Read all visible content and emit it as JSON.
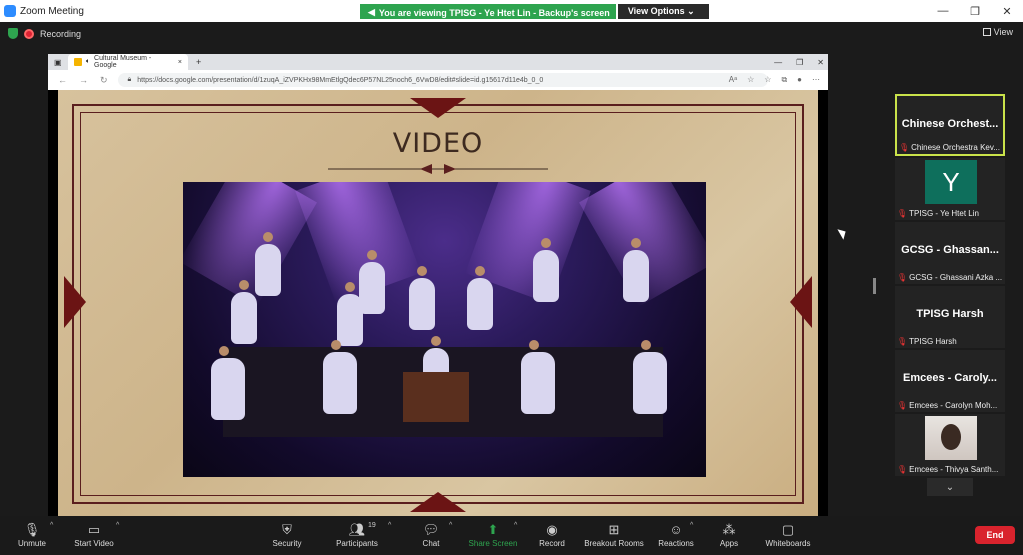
{
  "window": {
    "title": "Zoom Meeting",
    "viewing_banner": "You are viewing TPISG - Ye Htet Lin - Backup's screen",
    "view_options": "View Options",
    "view_options_caret": "⌄",
    "controls": [
      "—",
      "❐",
      "✕"
    ]
  },
  "status": {
    "recording": "Recording",
    "view": "View"
  },
  "browser": {
    "tab_title": "Cultural Museum - Google",
    "tab_close": "×",
    "new_tab": "+",
    "url": "https://docs.google.com/presentation/d/1zuqA_iZVPKHx98MmEtlgQdec6P57NL25noch6_6VwD8/edit#slide=id.g15617d11e4b_0_0",
    "window_controls": [
      "—",
      "❐",
      "✕"
    ],
    "nav": [
      "←",
      "→",
      "↻"
    ],
    "tools": [
      "Aᵃ",
      "☆",
      "☆",
      "⧉",
      "●",
      "⋯"
    ]
  },
  "slide": {
    "title": "VIDEO"
  },
  "gallery": [
    {
      "big": "Chinese  Orchest...",
      "label": "Chinese Orchestra Kev...",
      "active": true,
      "kind": "name"
    },
    {
      "big": "Y",
      "label": "TPISG - Ye Htet Lin",
      "kind": "avatar"
    },
    {
      "big": "GCSG  - Ghassan...",
      "label": "GCSG - Ghassani Azka ...",
      "kind": "name"
    },
    {
      "big": "TPISG Harsh",
      "label": "TPISG Harsh",
      "kind": "name"
    },
    {
      "big": "Emcees  - Caroly...",
      "label": "Emcees - Carolyn Moh...",
      "kind": "name"
    },
    {
      "big": "",
      "label": "Emcees - Thivya Santh...",
      "kind": "photo"
    }
  ],
  "gallery_scroll": "⌄",
  "toolbar": {
    "unmute": "Unmute",
    "start_video": "Start Video",
    "security": "Security",
    "participants": "Participants",
    "participants_count": "19",
    "chat": "Chat",
    "share_screen": "Share Screen",
    "record": "Record",
    "breakout_rooms": "Breakout Rooms",
    "reactions": "Reactions",
    "apps": "Apps",
    "whiteboards": "Whiteboards",
    "end": "End"
  },
  "colors": {
    "accent_green": "#2ea44f",
    "end_red": "#d9232d",
    "active_speaker": "#c9e24a"
  }
}
